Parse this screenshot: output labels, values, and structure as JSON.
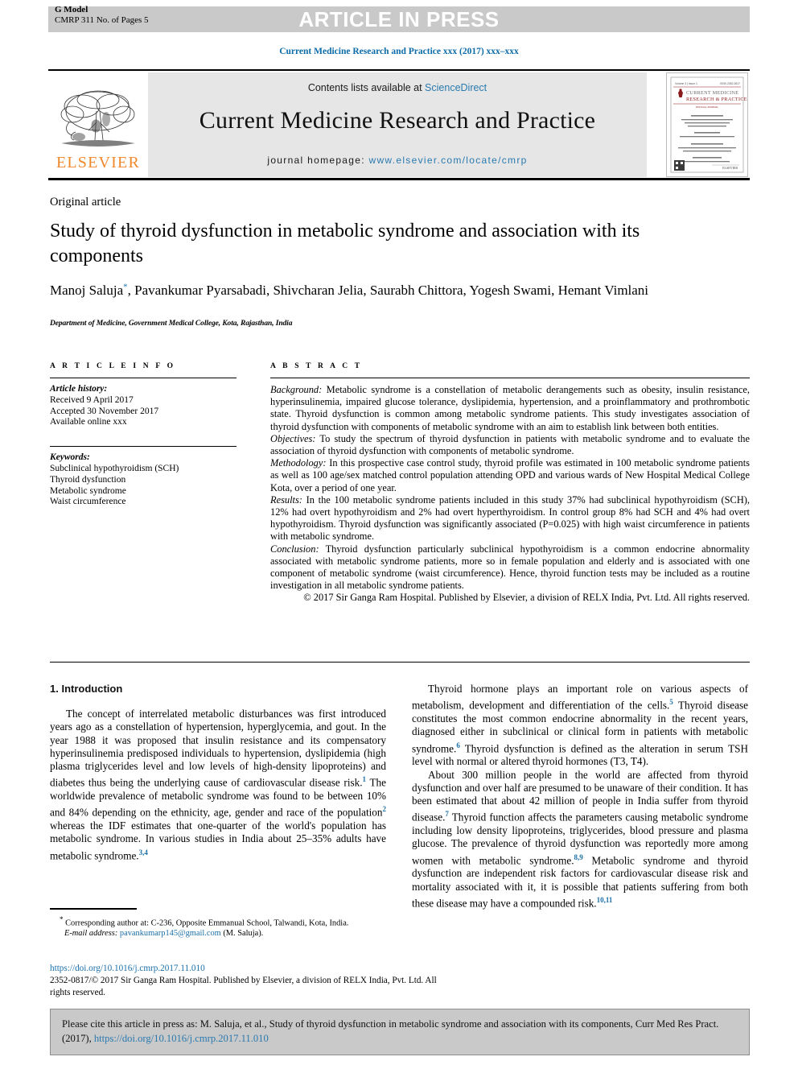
{
  "banner": {
    "article_in_press": "ARTICLE IN PRESS",
    "g_model": "G Model",
    "model_id": "CMRP 311 No. of Pages 5"
  },
  "journal_line": "Current Medicine Research and Practice xxx (2017) xxx–xxx",
  "masthead": {
    "contents_prefix": "Contents lists available at ",
    "contents_link": "ScienceDirect",
    "journal_title": "Current Medicine Research and Practice",
    "homepage_label": "journal homepage: ",
    "homepage_url": "www.elsevier.com/locate/cmrp",
    "publisher_logo_text": "ELSEVIER",
    "cover": {
      "title_line1": "CURRENT MEDICINE",
      "title_line2": "RESEARCH & PRACTICE",
      "issn_left": "Volume 3 | Issue 1",
      "issn_right": "ISSN 2352-0817",
      "footer_brand": "ELSEVIER"
    }
  },
  "article": {
    "type_label": "Original article",
    "title": "Study of thyroid dysfunction in metabolic syndrome and association with its components",
    "authors": "Manoj Saluja, Pavankumar Pyarsabadi, Shivcharan Jelia, Saurabh Chittora, Yogesh Swami, Hemant Vimlani",
    "corresponding_marker": "*",
    "affiliation": "Department of Medicine, Government Medical College, Kota, Rajasthan, India"
  },
  "article_info": {
    "heading": "A R T I C L E   I N F O",
    "history_label": "Article history:",
    "history": [
      "Received 9 April 2017",
      "Accepted 30 November 2017",
      "Available online xxx"
    ],
    "keywords_label": "Keywords:",
    "keywords": [
      "Subclinical hypothyroidism (SCH)",
      "Thyroid dysfunction",
      "Metabolic syndrome",
      "Waist circumference"
    ]
  },
  "abstract": {
    "heading": "A B S T R A C T",
    "sections": [
      {
        "label": "Background:",
        "text": " Metabolic syndrome is a constellation of metabolic derangements such as obesity, insulin resistance, hyperinsulinemia, impaired glucose tolerance, dyslipidemia, hypertension, and a proinflammatory and prothrombotic state. Thyroid dysfunction is common among metabolic syndrome patients. This study investigates association of thyroid dysfunction with components of metabolic syndrome with an aim to establish link between both entities."
      },
      {
        "label": "Objectives:",
        "text": " To study the spectrum of thyroid dysfunction in patients with metabolic syndrome and to evaluate the association of thyroid dysfunction with components of metabolic syndrome."
      },
      {
        "label": "Methodology:",
        "text": " In this prospective case control study, thyroid profile was estimated in 100 metabolic syndrome patients as well as 100 age/sex matched control population attending OPD and various wards of New Hospital Medical College Kota, over a period of one year."
      },
      {
        "label": "Results:",
        "text": " In the 100 metabolic syndrome patients included in this study 37% had subclinical hypothyroidism (SCH), 12% had overt hypothyroidism and 2% had overt hyperthyroidism. In control group 8% had SCH and 4% had overt hypothyroidism. Thyroid dysfunction was significantly associated (P=0.025) with high waist circumference in patients with metabolic syndrome."
      },
      {
        "label": "Conclusion:",
        "text": " Thyroid dysfunction particularly subclinical hypothyroidism is a common endocrine abnormality associated with metabolic syndrome patients, more so in female population and elderly and is associated with one component of metabolic syndrome (waist circumference). Hence, thyroid function tests may be included as a routine investigation in all metabolic syndrome patients."
      }
    ],
    "copyright": "© 2017 Sir Ganga Ram Hospital. Published by Elsevier, a division of RELX India, Pvt. Ltd. All rights reserved."
  },
  "introduction": {
    "heading": "1. Introduction",
    "left_paragraph_1_a": "The concept of interrelated metabolic disturbances was first introduced years ago as a constellation of hypertension, hyperglycemia, and gout. In the year 1988 it was proposed that insulin resistance and its compensatory hyperinsulinemia predisposed individuals to hypertension, dyslipidemia (high plasma triglycerides level and low levels of high-density lipoproteins) and diabetes thus being the underlying cause of cardiovascular disease risk.",
    "left_ref_1": "1",
    "left_paragraph_1_b": " The worldwide prevalence of metabolic syndrome was found to be between 10% and 84% depending on the ethnicity, age, gender and race of the population",
    "left_ref_2": "2",
    "left_paragraph_1_c": " whereas the IDF estimates that one-quarter of the world's population has metabolic syndrome. In various studies in India about 25–35% adults have metabolic syndrome.",
    "left_ref_3": "3,4",
    "right_paragraph_1_a": "Thyroid hormone plays an important role on various aspects of metabolism, development and differentiation of the cells.",
    "right_ref_5": "5",
    "right_paragraph_1_b": " Thyroid disease constitutes the most common endocrine abnormality in the recent years, diagnosed either in subclinical or clinical form in patients with metabolic syndrome.",
    "right_ref_6": "6",
    "right_paragraph_1_c": " Thyroid dysfunction is defined as the alteration in serum TSH level with normal or altered thyroid hormones (T3, T4).",
    "right_paragraph_2_a": "About 300 million people in the world are affected from thyroid dysfunction and over half are presumed to be unaware of their condition. It has been estimated that about 42 million of people in India suffer from thyroid disease.",
    "right_ref_7": "7",
    "right_paragraph_2_b": " Thyroid function affects the parameters causing metabolic syndrome including low density lipoproteins, triglycerides, blood pressure and plasma glucose. The prevalence of thyroid dysfunction was reportedly more among women with metabolic syndrome.",
    "right_ref_89": "8,9",
    "right_paragraph_2_c": " Metabolic syndrome and thyroid dysfunction are independent risk factors for cardiovascular disease risk and mortality associated with it, it is possible that patients suffering from both these disease may have a compounded risk.",
    "right_ref_1011": "10,11"
  },
  "footnotes": {
    "corresponding_marker": "*",
    "corresponding_text": " Corresponding author at: C-236, Opposite Emmanual School, Talwandi, Kota, India.",
    "email_label": "E-mail address:",
    "email": "pavankumarp145@gmail.com",
    "email_suffix": " (M. Saluja).",
    "doi": "https://doi.org/10.1016/j.cmrp.2017.11.010",
    "issn_line": "2352-0817/© 2017 Sir Ganga Ram Hospital. Published by Elsevier, a division of RELX India, Pvt. Ltd. All rights reserved."
  },
  "citation_footer": {
    "text_before": "Please cite this article in press as: M. Saluja, et al., Study of thyroid dysfunction in metabolic syndrome and association with its components, Curr Med Res Pract. (2017), ",
    "link": "https://doi.org/10.1016/j.cmrp.2017.11.010"
  },
  "colors": {
    "banner_gray": "#c9c9c9",
    "masthead_gray": "#e6e6e6",
    "link_blue": "#2a7ab0",
    "journal_blue": "#0b6ba8",
    "elsevier_orange": "#f0882c"
  }
}
